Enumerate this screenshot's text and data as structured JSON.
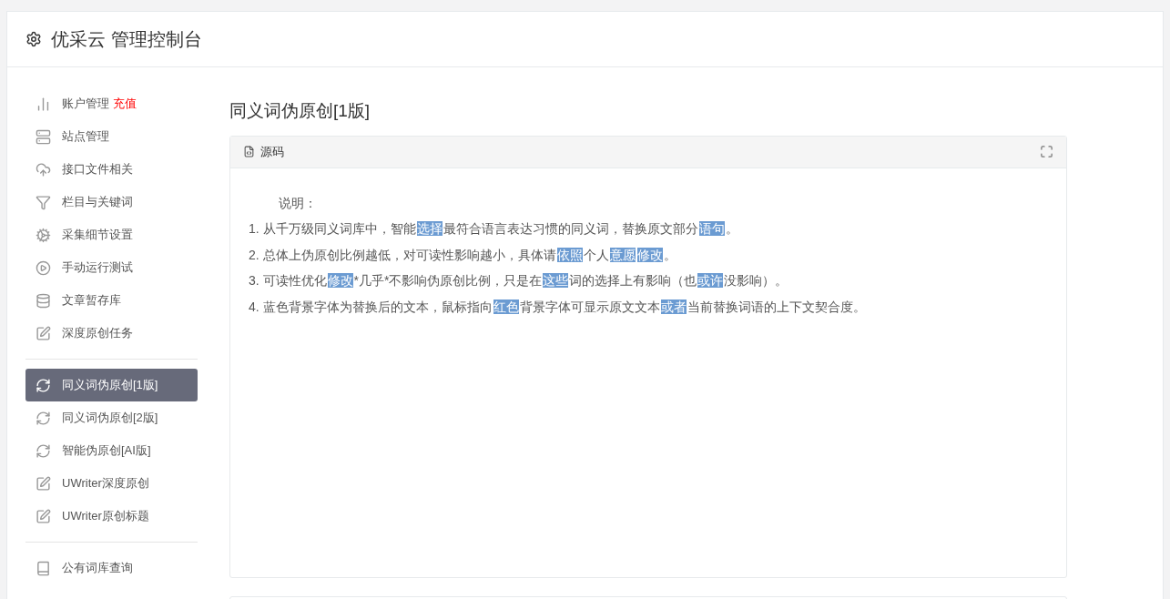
{
  "header": {
    "title": "优采云 管理控制台"
  },
  "sidebar": {
    "groups": [
      {
        "items": [
          {
            "label": "账户管理",
            "badge": "充值",
            "selected": false
          },
          {
            "label": "站点管理",
            "selected": false
          },
          {
            "label": "接口文件相关",
            "selected": false
          },
          {
            "label": "栏目与关键词",
            "selected": false
          },
          {
            "label": "采集细节设置",
            "selected": false
          },
          {
            "label": "手动运行测试",
            "selected": false
          },
          {
            "label": "文章暂存库",
            "selected": false
          },
          {
            "label": "深度原创任务",
            "selected": false
          }
        ]
      },
      {
        "items": [
          {
            "label": "同义词伪原创[1版]",
            "selected": true
          },
          {
            "label": "同义词伪原创[2版]",
            "selected": false
          },
          {
            "label": "智能伪原创[AI版]",
            "selected": false
          },
          {
            "label": "UWriter深度原创",
            "selected": false
          },
          {
            "label": "UWriter原创标题",
            "selected": false
          }
        ]
      },
      {
        "items": [
          {
            "label": "公有词库查询",
            "selected": false
          }
        ]
      }
    ]
  },
  "page": {
    "title": "同义词伪原创[1版]",
    "panel": {
      "title": "源码",
      "intro": "说明：",
      "lines": [
        [
          {
            "text": "1. 从千万级同义词库中，智能",
            "highlighted": false
          },
          {
            "text": "选择",
            "highlighted": true
          },
          {
            "text": "最符合语言表达习惯的同义词，替换原文部分",
            "highlighted": false
          },
          {
            "text": "语句",
            "highlighted": true
          },
          {
            "text": "。",
            "highlighted": false
          }
        ],
        [
          {
            "text": "2. 总体上伪原创比例越低，对可读性影响越小，具体请",
            "highlighted": false
          },
          {
            "text": "依照",
            "highlighted": true
          },
          {
            "text": "个人",
            "highlighted": false
          },
          {
            "text": "意愿",
            "highlighted": true
          },
          {
            "text": "修改",
            "highlighted": true
          },
          {
            "text": "。",
            "highlighted": false
          }
        ],
        [
          {
            "text": "3. 可读性优化",
            "highlighted": false
          },
          {
            "text": "修改",
            "highlighted": true
          },
          {
            "text": "*几乎*不影响伪原创比例，只是在",
            "highlighted": false
          },
          {
            "text": "这些",
            "highlighted": true
          },
          {
            "text": "词的选择上有影响（也",
            "highlighted": false
          },
          {
            "text": "或许",
            "highlighted": true
          },
          {
            "text": "没影响）。",
            "highlighted": false
          }
        ],
        [
          {
            "text": "4. 蓝色背景字体为替换后的文本，鼠标指向",
            "highlighted": false
          },
          {
            "text": "红色",
            "highlighted": true
          },
          {
            "text": "背景字体可显示原文文本",
            "highlighted": false
          },
          {
            "text": "或者",
            "highlighted": true
          },
          {
            "text": "当前替换词语的上下文契合度。",
            "highlighted": false
          }
        ]
      ]
    }
  }
}
